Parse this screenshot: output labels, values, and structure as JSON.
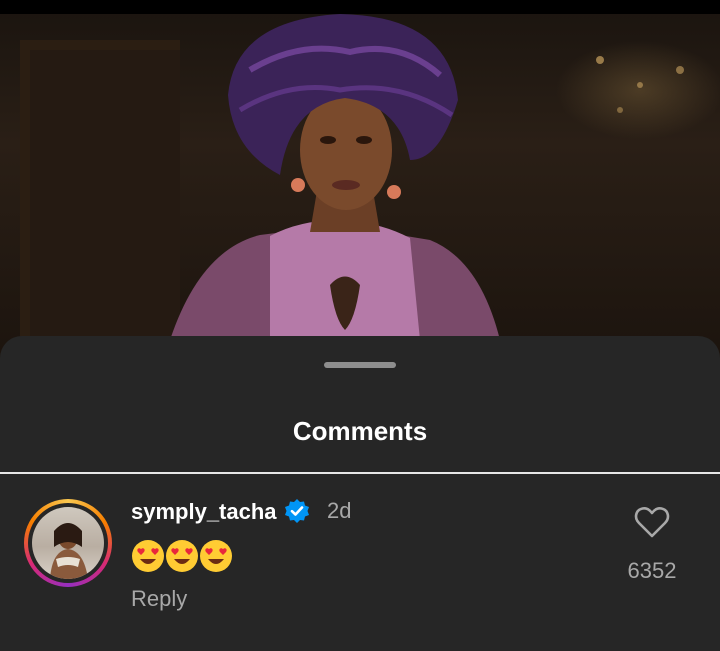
{
  "sheet": {
    "title": "Comments"
  },
  "comment": {
    "username": "symply_tacha",
    "verified": true,
    "time": "2d",
    "emojis": [
      "heart-eyes-emoji",
      "heart-eyes-emoji",
      "heart-eyes-emoji"
    ],
    "reply_label": "Reply",
    "like_count": "6352"
  },
  "colors": {
    "sheet_bg": "#262626",
    "verified_blue": "#0095f6",
    "secondary_text": "#a8a8a8"
  }
}
